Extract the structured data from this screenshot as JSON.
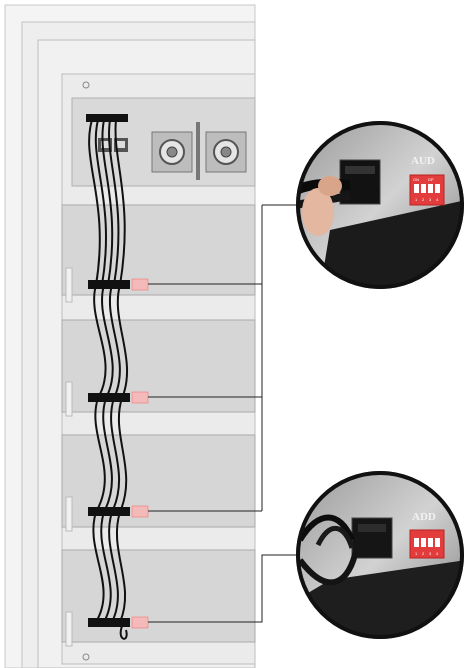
{
  "figure": {
    "panel_labels": [
      "AUD",
      "ADD"
    ],
    "dip_switch_top": {
      "labels_on": [
        "ON",
        "DP"
      ],
      "numbers": [
        "1",
        "2",
        "3",
        "4"
      ]
    },
    "dip_switch_bottom": {
      "labels_on": [
        "",
        ""
      ],
      "numbers": [
        "1",
        "2",
        "3",
        "4"
      ]
    },
    "colors": {
      "rack_frame": "#e9e9e9",
      "module_face": "#dcdcdc",
      "cable": "#111111",
      "dip_switch": "#e23c3c",
      "callout_bg": "#2a2a2a"
    },
    "icons": [
      "rj45-port-icon",
      "bnc-connector-icon",
      "dip-switch-icon",
      "ribbon-connector-icon"
    ]
  }
}
